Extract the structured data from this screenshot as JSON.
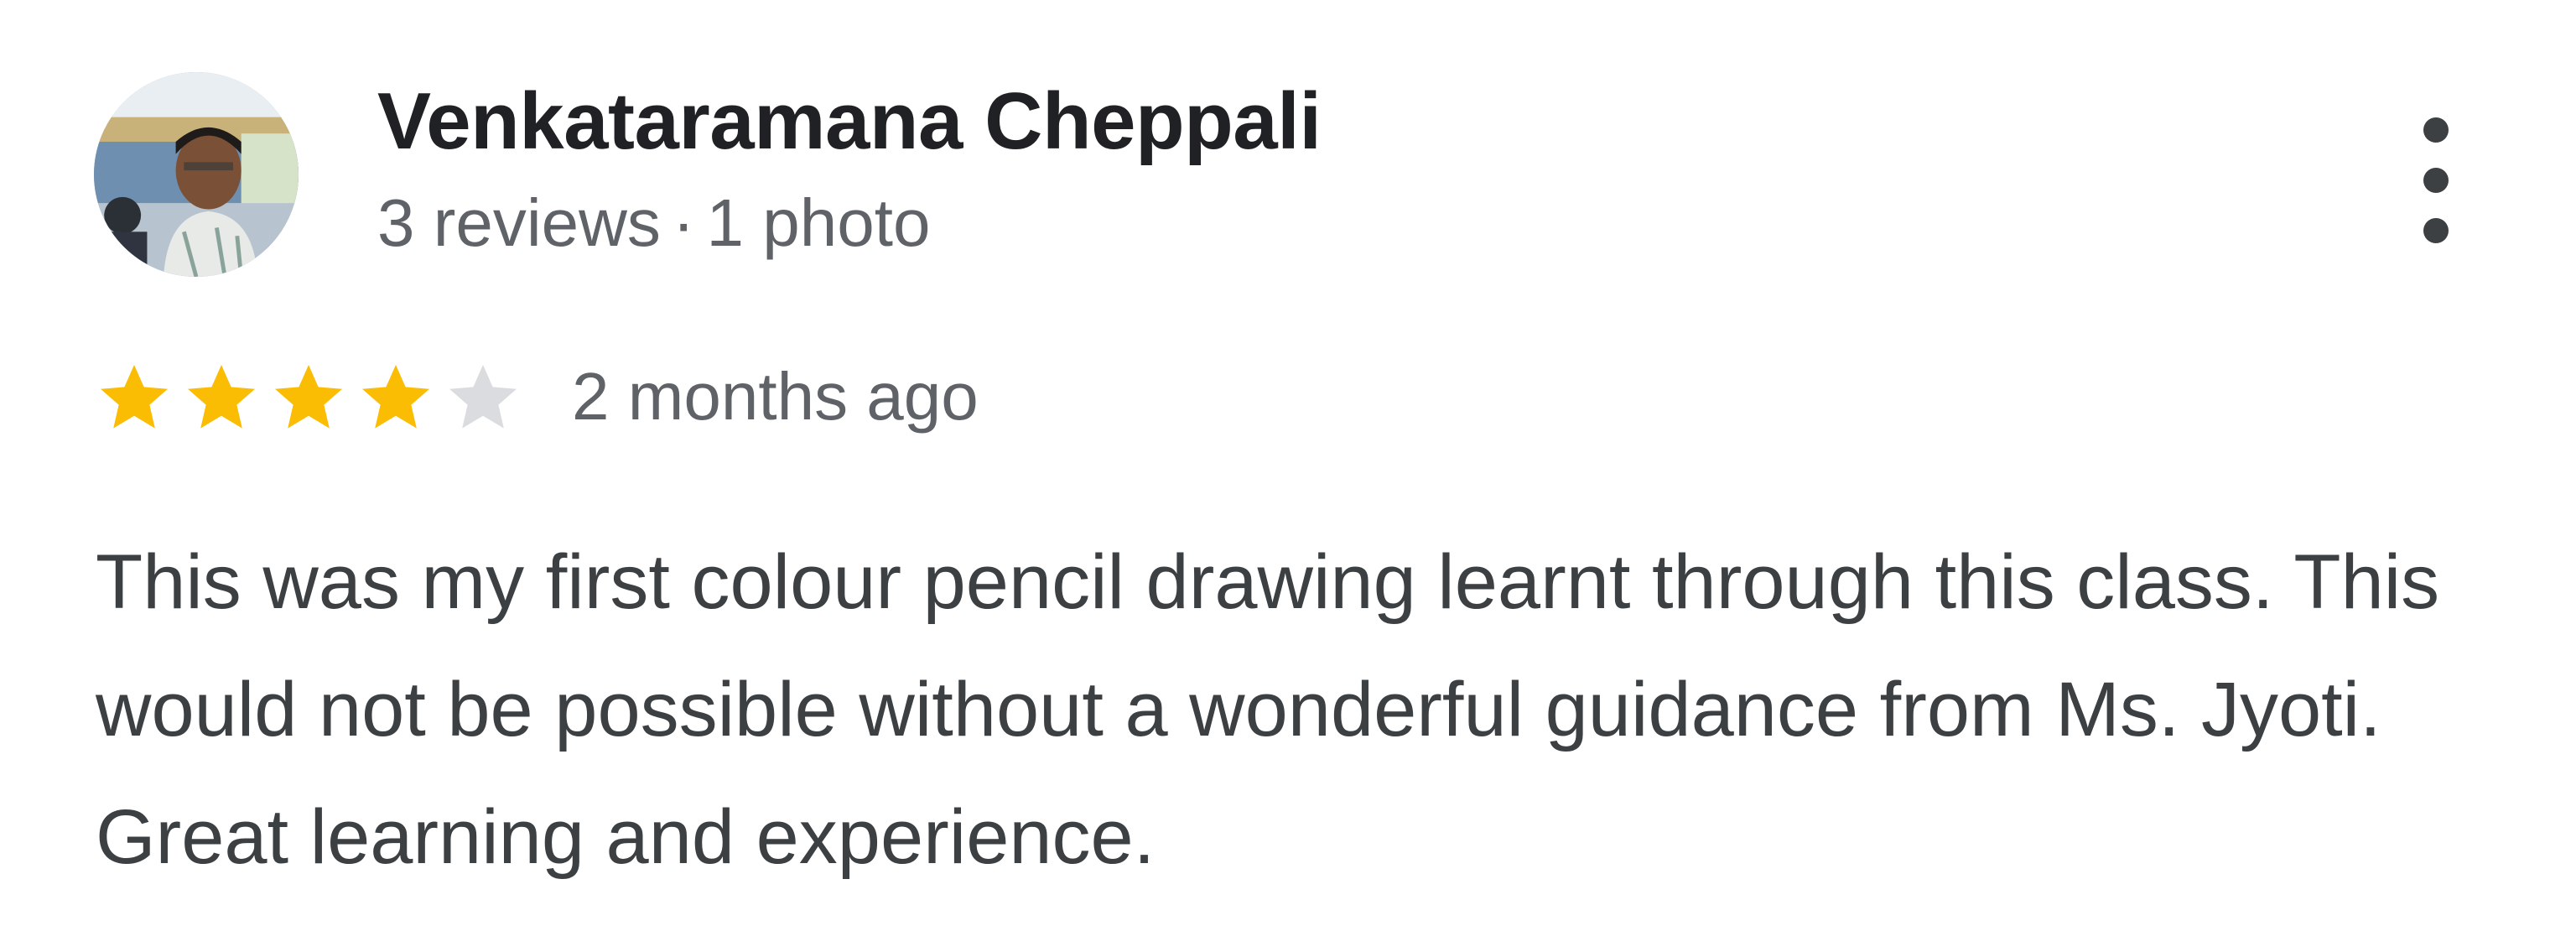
{
  "review": {
    "reviewer_name": "Venkataramana Cheppali",
    "reviews_count": "3 reviews",
    "separator": "·",
    "photos_count": "1 photo",
    "rating": 4,
    "rating_max": 5,
    "date": "2 months ago",
    "text": "This was my first colour pencil drawing learnt through this class. This would not be possible without a wonderful guidance from Ms. Jyoti. Great learning and experience."
  },
  "icons": {
    "menu": "more-vertical-icon",
    "star": "star-icon"
  },
  "colors": {
    "star_filled": "#FBBC04",
    "star_empty": "#DADCE0",
    "name": "#202124",
    "meta": "#5F6368",
    "body_text": "#3C4043"
  }
}
